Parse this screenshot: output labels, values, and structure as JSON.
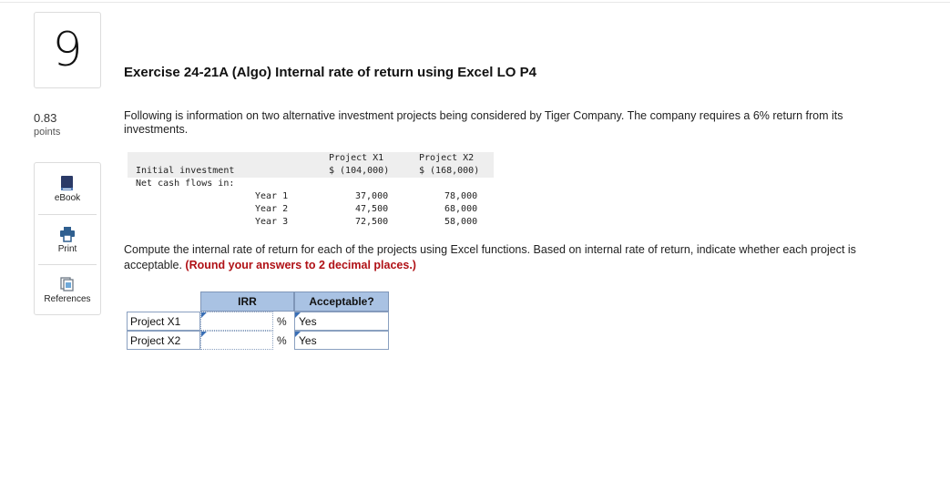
{
  "question": {
    "number": "9",
    "points_value": "0.83",
    "points_label": "points"
  },
  "tools": [
    {
      "label": "eBook",
      "icon": "ebook-icon"
    },
    {
      "label": "Print",
      "icon": "printer-icon"
    },
    {
      "label": "References",
      "icon": "references-icon"
    }
  ],
  "exercise": {
    "title": "Exercise 24-21A (Algo) Internal rate of return using Excel LO P4",
    "intro": "Following is information on two alternative investment projects being considered by Tiger Company. The company requires a 6% return from its investments.",
    "instruction": "Compute the internal rate of return for each of the projects using Excel functions. Based on internal rate of return, indicate whether each project is acceptable.",
    "instruction_note": "(Round your answers to 2 decimal places.)"
  },
  "data_table": {
    "col1_header": "Project X1",
    "col2_header": "Project X2",
    "initial_label": "Initial investment",
    "initial_x1": "$ (104,000)",
    "initial_x2": "$ (168,000)",
    "net_cash_label": "Net cash flows in:",
    "years": [
      {
        "label": "Year 1",
        "x1": "37,000",
        "x2": "78,000"
      },
      {
        "label": "Year 2",
        "x1": "47,500",
        "x2": "68,000"
      },
      {
        "label": "Year 3",
        "x1": "72,500",
        "x2": "58,000"
      }
    ]
  },
  "answer_table": {
    "irr_header": "IRR",
    "acceptable_header": "Acceptable?",
    "percent_sign": "%",
    "rows": [
      {
        "label": "Project X1",
        "irr_value": "",
        "acceptable": "Yes"
      },
      {
        "label": "Project X2",
        "irr_value": "",
        "acceptable": "Yes"
      }
    ]
  },
  "colors": {
    "header_fill": "#a9c2e3",
    "instruction_note": "#b01116",
    "ebook_icon": "#2b3a67",
    "print_icon": "#2f5f8f"
  }
}
